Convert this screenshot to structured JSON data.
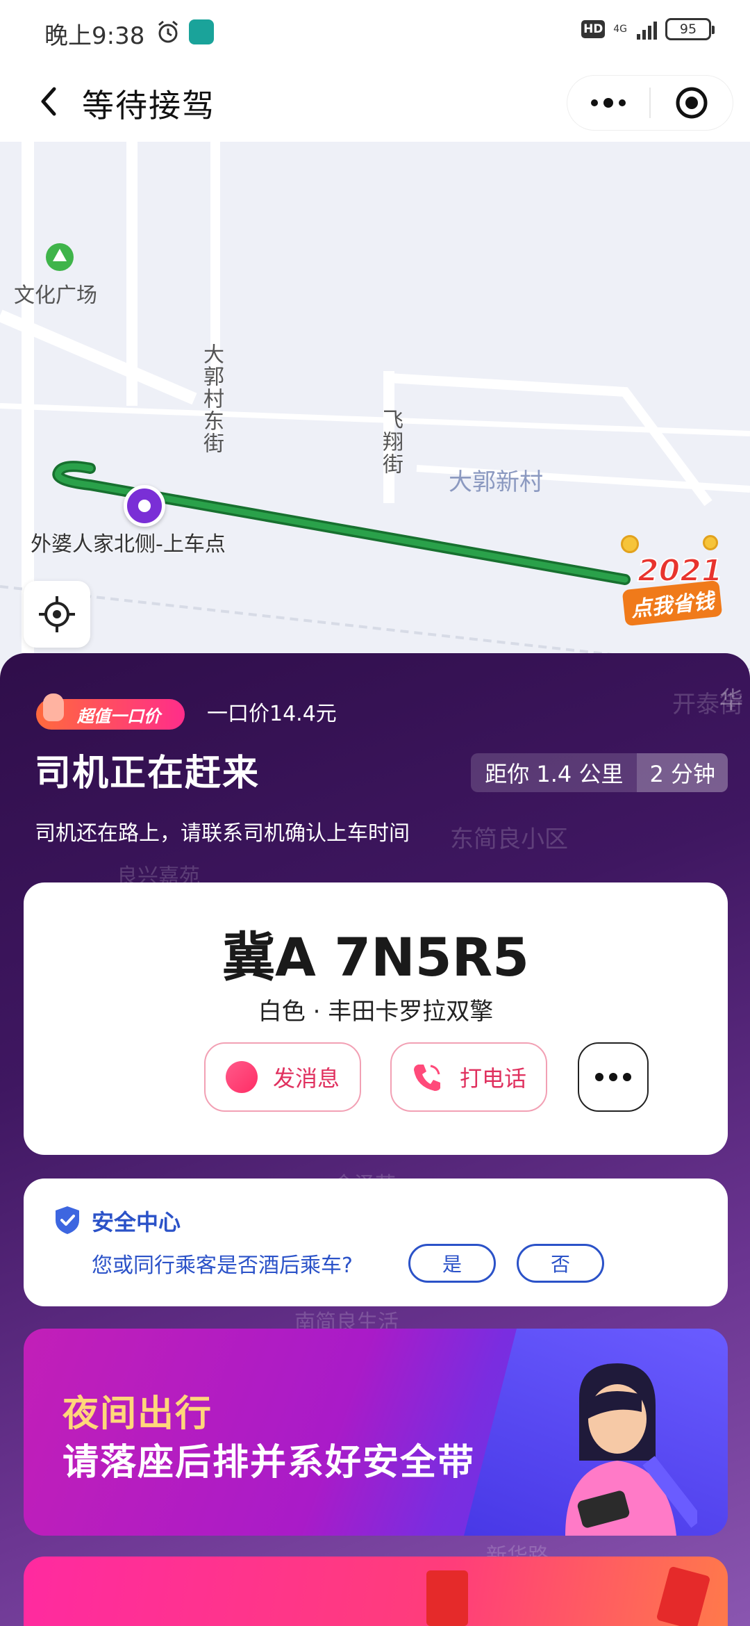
{
  "status_bar": {
    "time": "晚上9:38",
    "hd": "HD",
    "network": "4G",
    "battery": "95"
  },
  "header": {
    "title": "等待接驾"
  },
  "map": {
    "labels": {
      "park": "文化广场",
      "street1": "大郭村东街",
      "street2": "飞翔街",
      "village": "大郭新村",
      "street3": "开泰街",
      "edge": "华"
    },
    "pickup_label": "外婆人家北侧-上车点",
    "promo": {
      "year": "2021",
      "text": "点我省钱"
    },
    "route_color": "#1e8e3e"
  },
  "sheet": {
    "tag": "超值一口价",
    "fixed_price": "一口价14.4元",
    "status_title": "司机正在赶来",
    "eta_distance": "距你 1.4 公里",
    "eta_time": "2 分钟",
    "status_sub": "司机还在路上，请联系司机确认上车时间",
    "ghost_labels": [
      "东简良小区",
      "良兴嘉苑",
      "金泽苑",
      "南简良生活",
      "新华路"
    ]
  },
  "car": {
    "plate": "冀A 7N5R5",
    "description": "白色 · 丰田卡罗拉双擎",
    "message_label": "发消息",
    "call_label": "打电话"
  },
  "safety": {
    "title": "安全中心",
    "question": "您或同行乘客是否酒后乘车?",
    "yes": "是",
    "no": "否"
  },
  "banner": {
    "title": "夜间出行",
    "subtitle": "请落座后排并系好安全带"
  },
  "colors": {
    "accent": "#e0315f",
    "safety_blue": "#2b52c8",
    "pickup_pin": "#7a2fd6"
  }
}
